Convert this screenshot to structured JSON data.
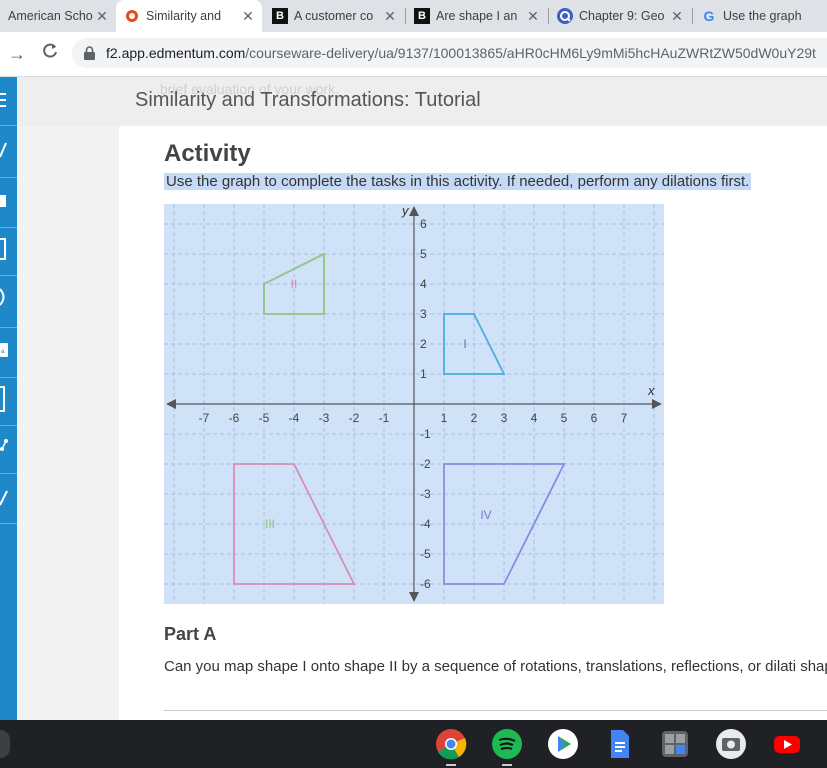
{
  "browser": {
    "tabs": [
      {
        "title": "American Scho",
        "icon": "american-school-icon"
      },
      {
        "title": "Similarity and",
        "icon": "edmentum-icon",
        "active": true
      },
      {
        "title": "A customer co",
        "icon": "brainly-icon"
      },
      {
        "title": "Are shape I an",
        "icon": "brainly-icon"
      },
      {
        "title": "Chapter 9: Geo",
        "icon": "quizlet-icon"
      },
      {
        "title": "Use the graph",
        "icon": "google-icon"
      }
    ],
    "url_host": "f2.app.edmentum.com",
    "url_path": "/courseware-delivery/ua/9137/100013865/aHR0cHM6Ly9mMi5hcHAuZWRtZW50dW0uY29t"
  },
  "header": {
    "ghost_text": "brief evaluation of your work.",
    "title": "Similarity and Transformations: Tutorial"
  },
  "activity": {
    "heading": "Activity",
    "instruction": "Use the graph to complete the tasks in this activity. If needed, perform any dilations first."
  },
  "chart_data": {
    "type": "coordinate-plane",
    "xlabel": "x",
    "ylabel": "y",
    "xlim": [
      -8,
      8
    ],
    "ylim": [
      -6.5,
      6.5
    ],
    "x_ticks": [
      "-7",
      "-6",
      "-5",
      "-4",
      "-3",
      "-2",
      "-1",
      "1",
      "2",
      "3",
      "4",
      "5",
      "6",
      "7"
    ],
    "y_ticks": [
      "6",
      "5",
      "4",
      "3",
      "2",
      "1",
      "-1",
      "-2",
      "-3",
      "-4",
      "-5",
      "-6"
    ],
    "grid": true,
    "background": "#cfe2f7",
    "shapes": [
      {
        "label": "I",
        "color": "#4aaee0",
        "label_pos": [
          1.7,
          2
        ],
        "points": [
          [
            1,
            1
          ],
          [
            1,
            3
          ],
          [
            2,
            3
          ],
          [
            3,
            1
          ]
        ]
      },
      {
        "label": "II",
        "color": "#8ec57c",
        "label_pos": [
          -4,
          4
        ],
        "points": [
          [
            -5,
            3
          ],
          [
            -5,
            4
          ],
          [
            -3,
            5
          ],
          [
            -3,
            3
          ]
        ]
      },
      {
        "label": "III",
        "color": "#d88db2",
        "label_pos": [
          -4.8,
          -4
        ],
        "points": [
          [
            -6,
            -2
          ],
          [
            -4,
            -2
          ],
          [
            -2,
            -6
          ],
          [
            -6,
            -6
          ]
        ]
      },
      {
        "label": "IV",
        "color": "#8d8be0",
        "label_pos": [
          2.4,
          -3.7
        ],
        "points": [
          [
            1,
            -2
          ],
          [
            5,
            -2
          ],
          [
            3,
            -6
          ],
          [
            1,
            -6
          ]
        ]
      }
    ],
    "label_colors": {
      "I": "#5a6fb0",
      "II": "#d88db2",
      "III": "#8ec57c",
      "IV": "#7a78d0"
    }
  },
  "partA": {
    "heading": "Part A",
    "text": "Can you map shape I onto shape II by a sequence of rotations, translations, reflections, or dilati shape II."
  },
  "taskbar": {
    "apps": [
      "chrome-icon",
      "spotify-icon",
      "play-store-icon",
      "docs-icon",
      "calculator-icon",
      "camera-icon",
      "youtube-icon"
    ]
  }
}
